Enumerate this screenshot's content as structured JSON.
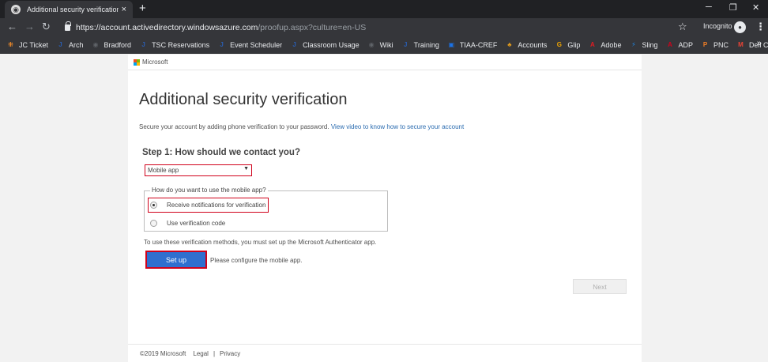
{
  "browser": {
    "tab_title": "Additional security verification",
    "tab_close": "×",
    "new_tab": "+",
    "url_host": "https://account.activedirectory.windowsazure.com",
    "url_path": "/proofup.aspx?culture=en-US",
    "incognito_label": "Incognito",
    "window_controls": [
      "─",
      "❐",
      "✕"
    ],
    "bookmarks": [
      {
        "label": "JC Ticket",
        "icon": "jc-icon",
        "glyph": "⁜",
        "color": "#f28c28"
      },
      {
        "label": "Arch",
        "icon": "j-icon",
        "glyph": "J",
        "color": "#2a5db0"
      },
      {
        "label": "Bradford",
        "icon": "globe-icon",
        "glyph": "◉",
        "color": "#5f6368"
      },
      {
        "label": "TSC Reservations",
        "icon": "j-icon",
        "glyph": "J",
        "color": "#2a5db0"
      },
      {
        "label": "Event Scheduler",
        "icon": "j-icon",
        "glyph": "J",
        "color": "#2a5db0"
      },
      {
        "label": "Classroom Usage",
        "icon": "j-icon",
        "glyph": "J",
        "color": "#2a5db0"
      },
      {
        "label": "Wiki",
        "icon": "globe-icon",
        "glyph": "◉",
        "color": "#5f6368"
      },
      {
        "label": "Training",
        "icon": "j-icon",
        "glyph": "J",
        "color": "#2a5db0"
      },
      {
        "label": "TIAA-CREF",
        "icon": "doc-icon",
        "glyph": "▣",
        "color": "#1a73e8"
      },
      {
        "label": "Accounts",
        "icon": "people-icon",
        "glyph": "♣",
        "color": "#e39c1c"
      },
      {
        "label": "Glip",
        "icon": "glip-icon",
        "glyph": "G",
        "color": "#f0a500"
      },
      {
        "label": "Adobe",
        "icon": "adobe-icon",
        "glyph": "A",
        "color": "#e01b22"
      },
      {
        "label": "Sling",
        "icon": "sling-icon",
        "glyph": "⚡",
        "color": "#1e88e5"
      },
      {
        "label": "ADP",
        "icon": "adp-icon",
        "glyph": "A",
        "color": "#d0021b"
      },
      {
        "label": "PNC",
        "icon": "pnc-icon",
        "glyph": "P",
        "color": "#f58025"
      },
      {
        "label": "Dell Chat",
        "icon": "gmail-icon",
        "glyph": "M",
        "color": "#ea4335"
      }
    ],
    "bookmarks_more": "»"
  },
  "header": {
    "brand": "Microsoft"
  },
  "main": {
    "title": "Additional security verification",
    "intro_text": "Secure your account by adding phone verification to your password.",
    "intro_link": "View video to know how to secure your account",
    "step_title": "Step 1: How should we contact you?",
    "contact_method": {
      "selected": "Mobile app",
      "arrow": "▼"
    },
    "usage": {
      "legend": "How do you want to use the mobile app?",
      "options": [
        {
          "label": "Receive notifications for verification",
          "checked": true
        },
        {
          "label": "Use verification code",
          "checked": false
        }
      ]
    },
    "authenticator_note": "To use these verification methods, you must set up the Microsoft Authenticator app.",
    "setup_button": "Set up",
    "setup_message": "Please configure the mobile app.",
    "next_button": "Next"
  },
  "footer": {
    "copyright": "©2019 Microsoft",
    "links": [
      "Legal",
      "Privacy"
    ],
    "separator": "|"
  },
  "colors": {
    "accent_blue": "#2f6fcf",
    "highlight_red": "#d0021b",
    "link": "#2b6cb0"
  }
}
